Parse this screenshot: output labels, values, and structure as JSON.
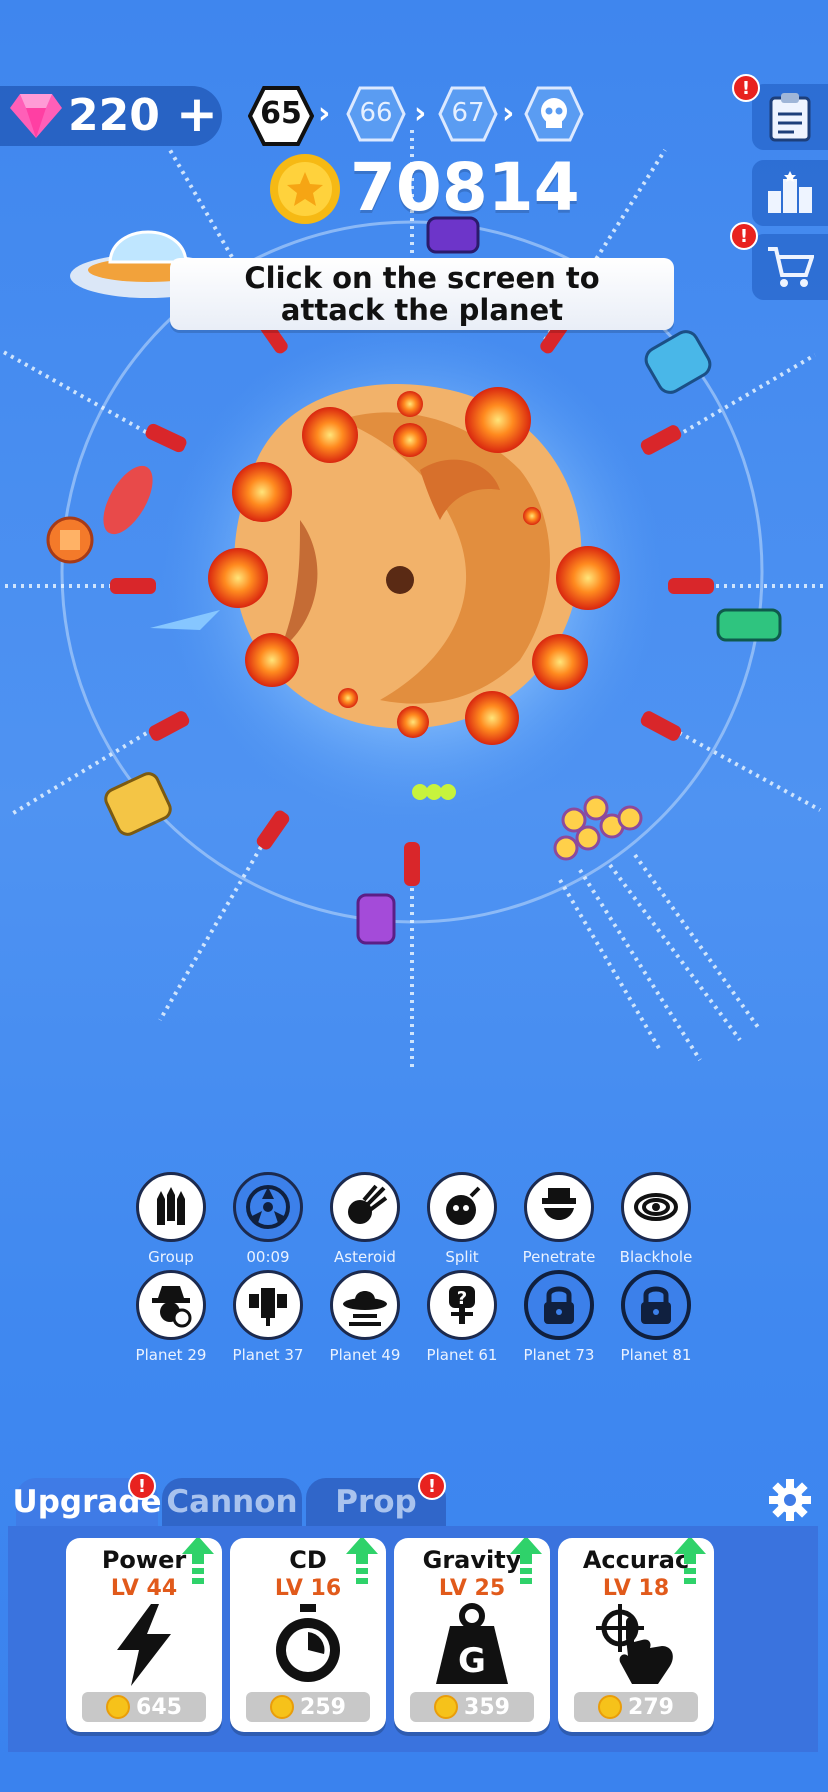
{
  "top_bar": {
    "gem_count": "220",
    "plus_icon": "plus-icon",
    "levels": [
      "65",
      "66",
      "67"
    ],
    "boss_icon": "skull-icon",
    "coin_count": "70814"
  },
  "side_buttons": [
    {
      "icon": "task-clipboard-icon",
      "alert": "!"
    },
    {
      "icon": "leaderboard-icon",
      "alert": ""
    },
    {
      "icon": "shop-cart-icon",
      "alert": "!"
    }
  ],
  "hint": {
    "line1": "Click on the screen to",
    "line2": "attack the planet"
  },
  "skills_row1": [
    {
      "label": "Group",
      "icon": "rocket-group-icon"
    },
    {
      "label": "00:09",
      "icon": "radiation-cooldown-icon"
    },
    {
      "label": "Asteroid",
      "icon": "asteroid-icon"
    },
    {
      "label": "Split",
      "icon": "split-bomb-icon"
    },
    {
      "label": "Penetrate",
      "icon": "penetrate-icon"
    },
    {
      "label": "Blackhole",
      "icon": "blackhole-icon"
    }
  ],
  "skills_row2": [
    {
      "label": "Planet 29",
      "icon": "alien-hat-clock-icon",
      "locked": false
    },
    {
      "label": "Planet 37",
      "icon": "satellite-icon",
      "locked": false
    },
    {
      "label": "Planet 49",
      "icon": "ufo-icon",
      "locked": false
    },
    {
      "label": "Planet 61",
      "icon": "question-drop-icon",
      "locked": false
    },
    {
      "label": "Planet 73",
      "icon": "lock-icon",
      "locked": true
    },
    {
      "label": "Planet 81",
      "icon": "lock-icon",
      "locked": true
    }
  ],
  "tabs": [
    {
      "label": "Upgrade",
      "active": true,
      "alert": "!"
    },
    {
      "label": "Cannon",
      "active": false,
      "alert": ""
    },
    {
      "label": "Prop",
      "active": false,
      "alert": "!"
    }
  ],
  "settings_icon": "gear-icon",
  "upgrades": [
    {
      "name": "Power",
      "level": "LV 44",
      "price": "645",
      "icon": "lightning-icon"
    },
    {
      "name": "CD",
      "level": "LV 16",
      "price": "259",
      "icon": "stopwatch-icon"
    },
    {
      "name": "Gravity",
      "level": "LV 25",
      "price": "359",
      "icon": "weight-icon",
      "weight_letter": "G"
    },
    {
      "name": "Accurac",
      "level": "LV 18",
      "price": "279",
      "icon": "target-hand-icon"
    }
  ],
  "colors": {
    "background": "#4f93f2",
    "planet": "#f2b26a",
    "explosion": "#f0481c",
    "missile": "#d9262a",
    "upgrade_level": "#e15a1b",
    "up_arrow": "#2fd26a",
    "alert": "#e8221f"
  }
}
